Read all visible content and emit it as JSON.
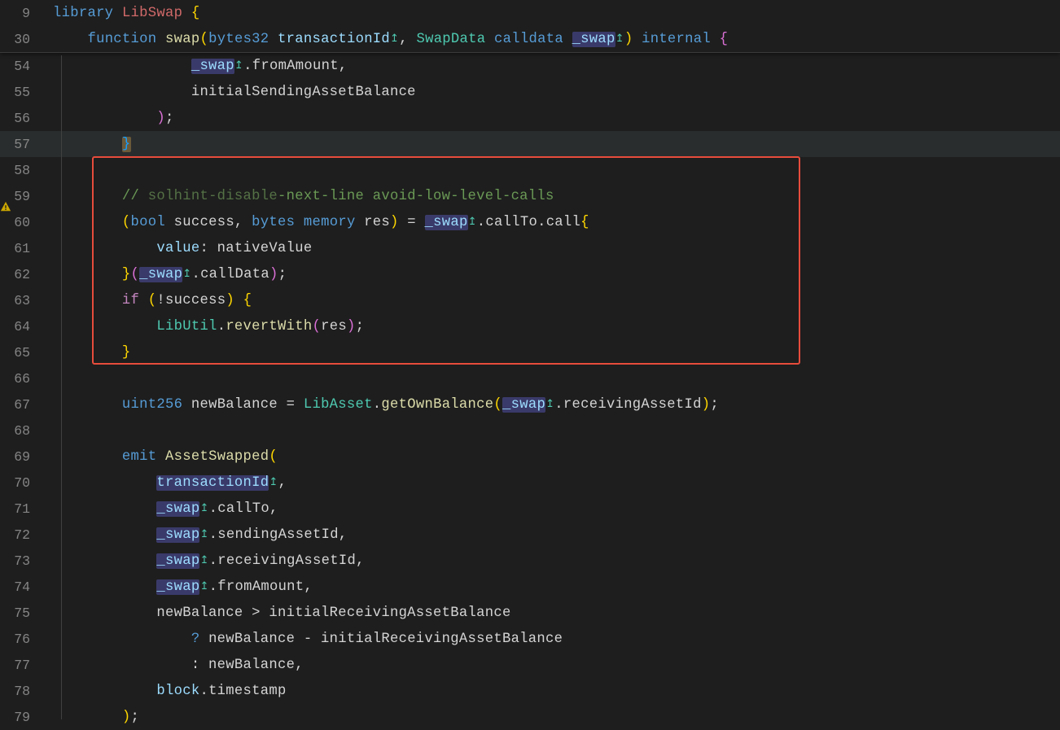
{
  "sticky": {
    "line1": {
      "num": "9",
      "kw": "library",
      "name": "LibSwap",
      "brace": "{"
    },
    "line2": {
      "num": "30",
      "kw": "function",
      "fn": "swap",
      "p1type": "bytes32",
      "p1name": "transactionId",
      "p2type": "SwapData",
      "p2loc": "calldata",
      "p2name": "_swap",
      "vis": "internal",
      "brace": "{"
    }
  },
  "lines": [
    {
      "num": "54",
      "indent": "                ",
      "tokens": [
        {
          "t": "hl",
          "v": "_swap"
        },
        {
          "t": "up"
        },
        {
          "t": "plain",
          "v": ".fromAmount,"
        }
      ]
    },
    {
      "num": "55",
      "indent": "                ",
      "tokens": [
        {
          "t": "plain",
          "v": "initialSendingAssetBalance"
        }
      ]
    },
    {
      "num": "56",
      "indent": "            ",
      "tokens": [
        {
          "t": "paren2",
          "v": ")"
        },
        {
          "t": "plain",
          "v": ";"
        }
      ]
    },
    {
      "num": "57",
      "indent": "        ",
      "hl": true,
      "tokens": [
        {
          "t": "hlbrace",
          "v": "}"
        }
      ]
    },
    {
      "num": "58",
      "indent": "",
      "tokens": []
    },
    {
      "num": "59",
      "indent": "        ",
      "tokens": [
        {
          "t": "comment",
          "v": "// "
        },
        {
          "t": "commentdim",
          "v": "solhint-disable"
        },
        {
          "t": "comment",
          "v": "-next-line avoid-low-level-calls"
        }
      ]
    },
    {
      "num": "60",
      "indent": "        ",
      "tokens": [
        {
          "t": "paren",
          "v": "("
        },
        {
          "t": "kw",
          "v": "bool"
        },
        {
          "t": "plain",
          "v": " success, "
        },
        {
          "t": "kw",
          "v": "bytes"
        },
        {
          "t": "plain",
          "v": " "
        },
        {
          "t": "kw",
          "v": "memory"
        },
        {
          "t": "plain",
          "v": " res"
        },
        {
          "t": "paren",
          "v": ")"
        },
        {
          "t": "plain",
          "v": " = "
        },
        {
          "t": "hl",
          "v": "_swap"
        },
        {
          "t": "up"
        },
        {
          "t": "plain",
          "v": ".callTo.call"
        },
        {
          "t": "paren",
          "v": "{"
        }
      ]
    },
    {
      "num": "61",
      "indent": "            ",
      "tokens": [
        {
          "t": "ident",
          "v": "value"
        },
        {
          "t": "plain",
          "v": ": nativeValue"
        }
      ]
    },
    {
      "num": "62",
      "indent": "        ",
      "tokens": [
        {
          "t": "paren",
          "v": "}"
        },
        {
          "t": "paren2",
          "v": "("
        },
        {
          "t": "hl",
          "v": "_swap"
        },
        {
          "t": "up"
        },
        {
          "t": "plain",
          "v": ".callData"
        },
        {
          "t": "paren2",
          "v": ")"
        },
        {
          "t": "plain",
          "v": ";"
        }
      ]
    },
    {
      "num": "63",
      "indent": "        ",
      "tokens": [
        {
          "t": "if",
          "v": "if"
        },
        {
          "t": "plain",
          "v": " "
        },
        {
          "t": "paren",
          "v": "("
        },
        {
          "t": "plain",
          "v": "!success"
        },
        {
          "t": "paren",
          "v": ")"
        },
        {
          "t": "plain",
          "v": " "
        },
        {
          "t": "paren",
          "v": "{"
        }
      ]
    },
    {
      "num": "64",
      "indent": "            ",
      "tokens": [
        {
          "t": "type",
          "v": "LibUtil"
        },
        {
          "t": "plain",
          "v": "."
        },
        {
          "t": "fn",
          "v": "revertWith"
        },
        {
          "t": "paren2",
          "v": "("
        },
        {
          "t": "plain",
          "v": "res"
        },
        {
          "t": "paren2",
          "v": ")"
        },
        {
          "t": "plain",
          "v": ";"
        }
      ]
    },
    {
      "num": "65",
      "indent": "        ",
      "tokens": [
        {
          "t": "paren",
          "v": "}"
        }
      ]
    },
    {
      "num": "66",
      "indent": "",
      "tokens": []
    },
    {
      "num": "67",
      "indent": "        ",
      "tokens": [
        {
          "t": "kw",
          "v": "uint256"
        },
        {
          "t": "plain",
          "v": " newBalance = "
        },
        {
          "t": "type",
          "v": "LibAsset"
        },
        {
          "t": "plain",
          "v": "."
        },
        {
          "t": "fn",
          "v": "getOwnBalance"
        },
        {
          "t": "paren",
          "v": "("
        },
        {
          "t": "hl",
          "v": "_swap"
        },
        {
          "t": "up"
        },
        {
          "t": "plain",
          "v": ".receivingAssetId"
        },
        {
          "t": "paren",
          "v": ")"
        },
        {
          "t": "plain",
          "v": ";"
        }
      ]
    },
    {
      "num": "68",
      "indent": "",
      "tokens": []
    },
    {
      "num": "69",
      "indent": "        ",
      "tokens": [
        {
          "t": "kw",
          "v": "emit"
        },
        {
          "t": "plain",
          "v": " "
        },
        {
          "t": "fn",
          "v": "AssetSwapped"
        },
        {
          "t": "paren",
          "v": "("
        }
      ]
    },
    {
      "num": "70",
      "indent": "            ",
      "tokens": [
        {
          "t": "hl",
          "v": "transactionId"
        },
        {
          "t": "up"
        },
        {
          "t": "plain",
          "v": ","
        }
      ]
    },
    {
      "num": "71",
      "indent": "            ",
      "tokens": [
        {
          "t": "hl",
          "v": "_swap"
        },
        {
          "t": "up"
        },
        {
          "t": "plain",
          "v": ".callTo,"
        }
      ]
    },
    {
      "num": "72",
      "indent": "            ",
      "tokens": [
        {
          "t": "hl",
          "v": "_swap"
        },
        {
          "t": "up"
        },
        {
          "t": "plain",
          "v": ".sendingAssetId,"
        }
      ]
    },
    {
      "num": "73",
      "indent": "            ",
      "tokens": [
        {
          "t": "hl",
          "v": "_swap"
        },
        {
          "t": "up"
        },
        {
          "t": "plain",
          "v": ".receivingAssetId,"
        }
      ]
    },
    {
      "num": "74",
      "indent": "            ",
      "tokens": [
        {
          "t": "hl",
          "v": "_swap"
        },
        {
          "t": "up"
        },
        {
          "t": "plain",
          "v": ".fromAmount,"
        }
      ]
    },
    {
      "num": "75",
      "indent": "            ",
      "tokens": [
        {
          "t": "plain",
          "v": "newBalance > initialReceivingAssetBalance"
        }
      ]
    },
    {
      "num": "76",
      "indent": "                ",
      "tokens": [
        {
          "t": "kw",
          "v": "?"
        },
        {
          "t": "plain",
          "v": " newBalance - initialReceivingAssetBalance"
        }
      ]
    },
    {
      "num": "77",
      "indent": "                ",
      "tokens": [
        {
          "t": "plain",
          "v": ": newBalance,"
        }
      ]
    },
    {
      "num": "78",
      "indent": "            ",
      "tokens": [
        {
          "t": "ident",
          "v": "block"
        },
        {
          "t": "plain",
          "v": ".timestamp"
        }
      ]
    },
    {
      "num": "79",
      "indent": "        ",
      "tokens": [
        {
          "t": "paren",
          "v": ")"
        },
        {
          "t": "plain",
          "v": ";"
        }
      ]
    }
  ]
}
